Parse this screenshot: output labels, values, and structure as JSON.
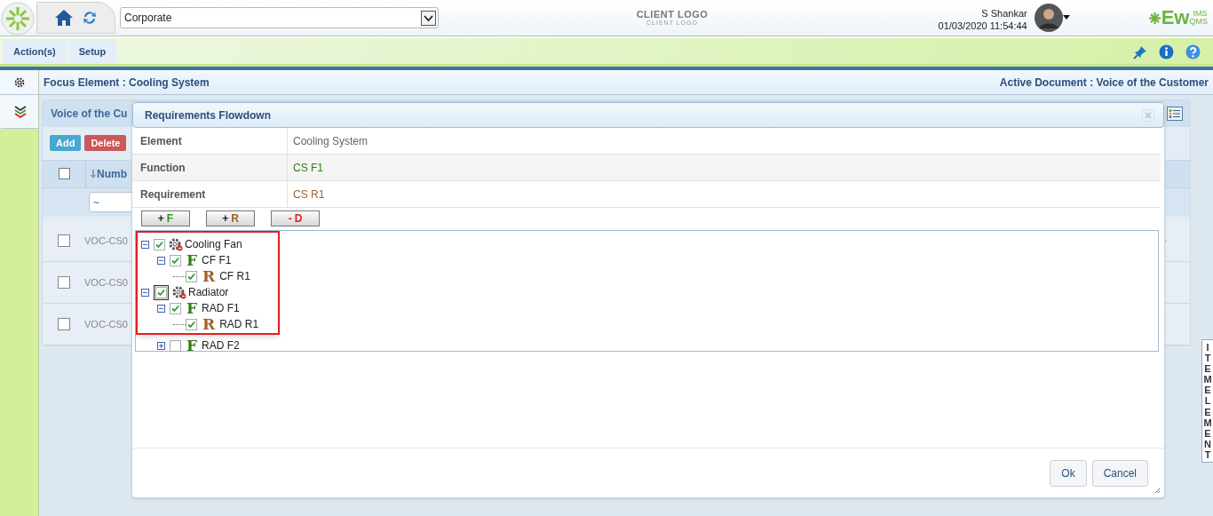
{
  "header": {
    "company_select": "Corporate",
    "client_logo": "CLIENT LOGO",
    "client_logo_sub": "CLIENT LOGO",
    "user_name": "S Shankar",
    "datetime": "01/03/2020 11:54:44",
    "brand": {
      "main": "Ew",
      "top": "IMS",
      "bottom": "QMS"
    }
  },
  "nav": {
    "tabs": [
      {
        "label": "Action(s)",
        "selected": false
      },
      {
        "label": "Setup",
        "selected": false
      }
    ]
  },
  "sidebar": {
    "items": [
      {
        "kind": "gear",
        "selected": false
      },
      {
        "kind": "chevrons",
        "selected": true
      }
    ]
  },
  "focus_bar": {
    "focus": "Focus Element : Cooling System",
    "active": "Active Document : Voice of the Customer"
  },
  "panel": {
    "title": "Voice of the Cu",
    "buttons": [
      {
        "label": "Add",
        "kind": "add"
      },
      {
        "label": "Delete",
        "kind": "delete"
      }
    ],
    "column_1": "Numb",
    "header_checked": false,
    "filter": "~",
    "rows": [
      {
        "checked": false,
        "number": "VOC-CS0"
      },
      {
        "checked": false,
        "number": "VOC-CS0"
      },
      {
        "checked": false,
        "number": "VOC-CS0"
      }
    ]
  },
  "side_tab": "ITEM ELEMENT",
  "dialog": {
    "title": "Requirements Flowdown",
    "fields": [
      {
        "label": "Element",
        "value": "Cooling System",
        "kind": "plain"
      },
      {
        "label": "Function",
        "value": "CS F1",
        "kind": "function"
      },
      {
        "label": "Requirement",
        "value": "CS R1",
        "kind": "requirement"
      }
    ],
    "tree_buttons": [
      {
        "sign": "+",
        "letter": "F",
        "kind": "function"
      },
      {
        "sign": "+",
        "letter": "R",
        "kind": "requirement"
      },
      {
        "sign": "-",
        "letter": "D",
        "kind": "delete"
      }
    ],
    "tree": [
      {
        "kind": "component",
        "label": "Cooling Fan",
        "checked": true,
        "expanded": true,
        "children": [
          {
            "kind": "function",
            "letter": "F",
            "label": "CF F1",
            "checked": true,
            "expanded": true,
            "children": [
              {
                "kind": "requirement",
                "letter": "R",
                "label": "CF R1",
                "checked": true
              }
            ]
          }
        ]
      },
      {
        "kind": "component",
        "label": "Radiator",
        "checked": true,
        "expanded": true,
        "focused": true,
        "children": [
          {
            "kind": "function",
            "letter": "F",
            "label": "RAD F1",
            "checked": true,
            "expanded": true,
            "children": [
              {
                "kind": "requirement",
                "letter": "R",
                "label": "RAD R1",
                "checked": true
              }
            ]
          },
          {
            "kind": "function",
            "letter": "F",
            "label": "RAD F2",
            "checked": false,
            "expanded": false
          }
        ]
      }
    ],
    "footer_buttons": [
      "Ok",
      "Cancel"
    ]
  }
}
